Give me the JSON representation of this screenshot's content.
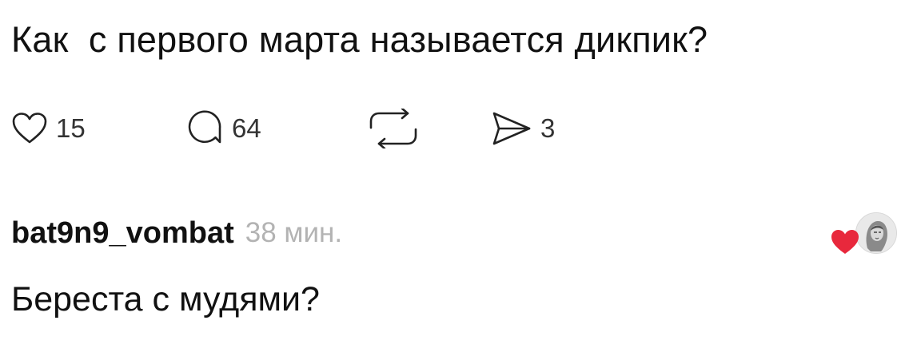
{
  "post": {
    "text": "Как  с первого марта называется дикпик?"
  },
  "actions": {
    "like": {
      "icon": "heart-outline-icon",
      "count": "15"
    },
    "comment": {
      "icon": "speech-bubble-icon",
      "count": "64"
    },
    "repost": {
      "icon": "repost-arrows-icon"
    },
    "share": {
      "icon": "send-arrow-icon",
      "count": "3"
    }
  },
  "comment": {
    "username": "bat9n9_vombat",
    "time": "38 мин.",
    "text": "Береста с мудями?",
    "author_like": {
      "icon": "red-heart-icon",
      "avatar": "avatar",
      "heart_color": "#e8283c"
    }
  }
}
